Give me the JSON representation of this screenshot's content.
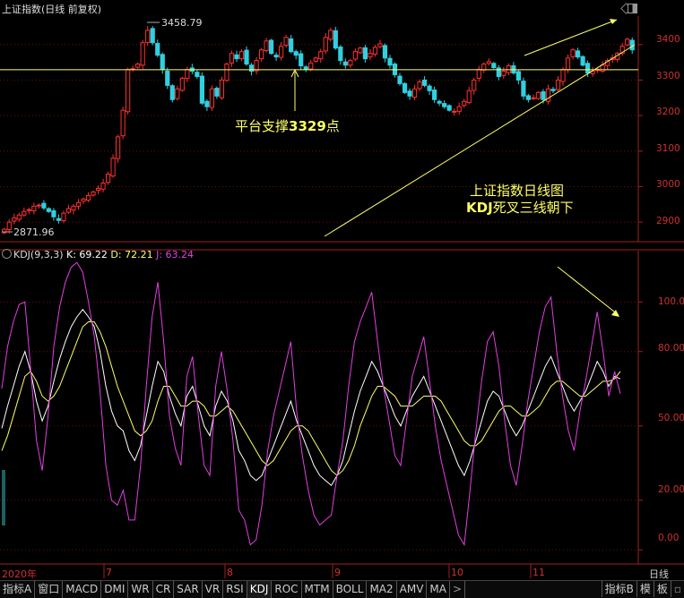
{
  "header": {
    "title": "上证指数(日线 前复权)",
    "kdj_name": "KDJ(9,3,3)",
    "k_label": "K: 69.22",
    "d_label": "D: 72.21",
    "j_label": "J: 63.24"
  },
  "price_axis": [
    "3400",
    "3300",
    "3200",
    "3100",
    "3000",
    "2900"
  ],
  "kdj_axis": [
    "100.00",
    "80.00",
    "50.00",
    "20.00",
    "0.00"
  ],
  "x_axis": [
    "2020年",
    "7",
    "8",
    "9",
    "10",
    "11"
  ],
  "x_axis_right": "日线",
  "price_marks": {
    "high": "3458.79",
    "low": "2871.96"
  },
  "annotations": {
    "support_prefix": "平台支撑",
    "support_value": "3329",
    "support_suffix": "点",
    "caption_line1": "上证指数日线图",
    "caption_kdj": "KDJ",
    "caption_line2": "死叉三线朝下"
  },
  "tabs": [
    "指标A",
    "窗口",
    "MACD",
    "DMI",
    "WR",
    "CR",
    "SAR",
    "VR",
    "RSI",
    "KDJ",
    "ROC",
    "MTM",
    "BOLL",
    "MA2",
    "AMV",
    "MA"
  ],
  "tabs_arrow": ">",
  "tabs_right": [
    "指标B",
    "模",
    "板"
  ],
  "colors": {
    "up": "#ff3030",
    "down": "#30d0e0",
    "k": "#ffffff",
    "d": "#ffff66",
    "j": "#e040e0",
    "axis": "#d03030"
  },
  "chart_data": [
    {
      "type": "candlestick",
      "title": "上证指数(日线 前复权)",
      "ylim": [
        2850,
        3480
      ],
      "yticks": [
        2900,
        3000,
        3100,
        3200,
        3300,
        3400
      ],
      "highlight": {
        "high": 3458.79,
        "low": 2871.96,
        "support": 3329
      },
      "closes": [
        2880,
        2900,
        2912,
        2920,
        2930,
        2935,
        2945,
        2948,
        2940,
        2930,
        2915,
        2905,
        2925,
        2938,
        2945,
        2955,
        2965,
        2975,
        2985,
        2995,
        3010,
        3035,
        3080,
        3140,
        3215,
        3330,
        3332,
        3345,
        3405,
        3440,
        3405,
        3370,
        3330,
        3285,
        3245,
        3275,
        3305,
        3330,
        3325,
        3310,
        3235,
        3225,
        3275,
        3255,
        3300,
        3345,
        3375,
        3360,
        3380,
        3345,
        3325,
        3355,
        3385,
        3410,
        3375,
        3365,
        3395,
        3420,
        3380,
        3370,
        3340,
        3330,
        3348,
        3362,
        3380,
        3420,
        3440,
        3390,
        3355,
        3342,
        3355,
        3380,
        3390,
        3360,
        3375,
        3392,
        3402,
        3362,
        3342,
        3315,
        3290,
        3265,
        3255,
        3275,
        3295,
        3285,
        3270,
        3245,
        3235,
        3225,
        3215,
        3212,
        3225,
        3240,
        3270,
        3300,
        3330,
        3345,
        3352,
        3335,
        3310,
        3325,
        3340,
        3320,
        3300,
        3255,
        3245,
        3250,
        3265,
        3245,
        3275,
        3270,
        3300,
        3330,
        3362,
        3385,
        3365,
        3342,
        3320,
        3325,
        3330,
        3342,
        3355,
        3362,
        3375,
        3395,
        3415,
        3385
      ]
    },
    {
      "type": "line",
      "title": "KDJ(9,3,3)",
      "ylim": [
        -5,
        120
      ],
      "yticks": [
        0,
        20,
        50,
        80,
        100
      ],
      "series": [
        {
          "name": "K",
          "values": [
            49,
            58,
            66,
            74,
            80,
            72,
            60,
            52,
            58,
            68,
            77,
            84,
            90,
            94,
            97,
            94,
            90,
            80,
            66,
            56,
            50,
            48,
            40,
            36,
            42,
            54,
            66,
            76,
            72,
            62,
            55,
            50,
            62,
            66,
            58,
            50,
            46,
            58,
            64,
            60,
            52,
            40,
            36,
            30,
            28,
            30,
            36,
            42,
            48,
            54,
            60,
            52,
            46,
            40,
            34,
            30,
            28,
            26,
            30,
            36,
            46,
            56,
            64,
            70,
            76,
            72,
            66,
            60,
            54,
            50,
            56,
            62,
            66,
            70,
            64,
            58,
            52,
            46,
            40,
            34,
            30,
            36,
            44,
            52,
            60,
            64,
            62,
            56,
            50,
            46,
            50,
            56,
            62,
            68,
            74,
            78,
            72,
            66,
            60,
            56,
            60,
            64,
            70,
            76,
            72,
            66,
            70,
            69
          ]
        },
        {
          "name": "D",
          "values": [
            40,
            46,
            54,
            62,
            70,
            72,
            68,
            62,
            60,
            62,
            66,
            72,
            78,
            84,
            90,
            92,
            92,
            88,
            82,
            74,
            66,
            60,
            54,
            48,
            46,
            48,
            52,
            60,
            66,
            66,
            62,
            58,
            58,
            60,
            60,
            58,
            54,
            54,
            56,
            58,
            56,
            52,
            48,
            44,
            40,
            36,
            34,
            36,
            40,
            44,
            48,
            50,
            50,
            48,
            44,
            40,
            36,
            32,
            30,
            32,
            36,
            42,
            50,
            56,
            62,
            66,
            66,
            64,
            62,
            58,
            58,
            58,
            60,
            62,
            62,
            62,
            60,
            56,
            52,
            48,
            44,
            42,
            42,
            44,
            48,
            52,
            56,
            58,
            58,
            56,
            54,
            54,
            56,
            58,
            62,
            66,
            68,
            68,
            66,
            64,
            62,
            62,
            64,
            66,
            68,
            68,
            69,
            72
          ]
        },
        {
          "name": "J",
          "values": [
            65,
            82,
            92,
            99,
            100,
            73,
            44,
            32,
            54,
            82,
            98,
            108,
            114,
            116,
            112,
            100,
            86,
            64,
            34,
            20,
            18,
            24,
            12,
            12,
            34,
            66,
            94,
            108,
            84,
            54,
            41,
            34,
            70,
            78,
            54,
            34,
            30,
            66,
            80,
            64,
            44,
            16,
            12,
            2,
            4,
            18,
            40,
            54,
            64,
            74,
            84,
            56,
            38,
            24,
            14,
            10,
            12,
            14,
            30,
            44,
            66,
            84,
            92,
            98,
            104,
            84,
            66,
            52,
            38,
            34,
            52,
            70,
            78,
            86,
            68,
            50,
            36,
            26,
            16,
            6,
            2,
            24,
            48,
            68,
            84,
            88,
            74,
            52,
            34,
            26,
            42,
            60,
            74,
            88,
            98,
            102,
            80,
            62,
            48,
            40,
            56,
            68,
            82,
            96,
            80,
            62,
            72,
            63
          ]
        }
      ]
    }
  ]
}
